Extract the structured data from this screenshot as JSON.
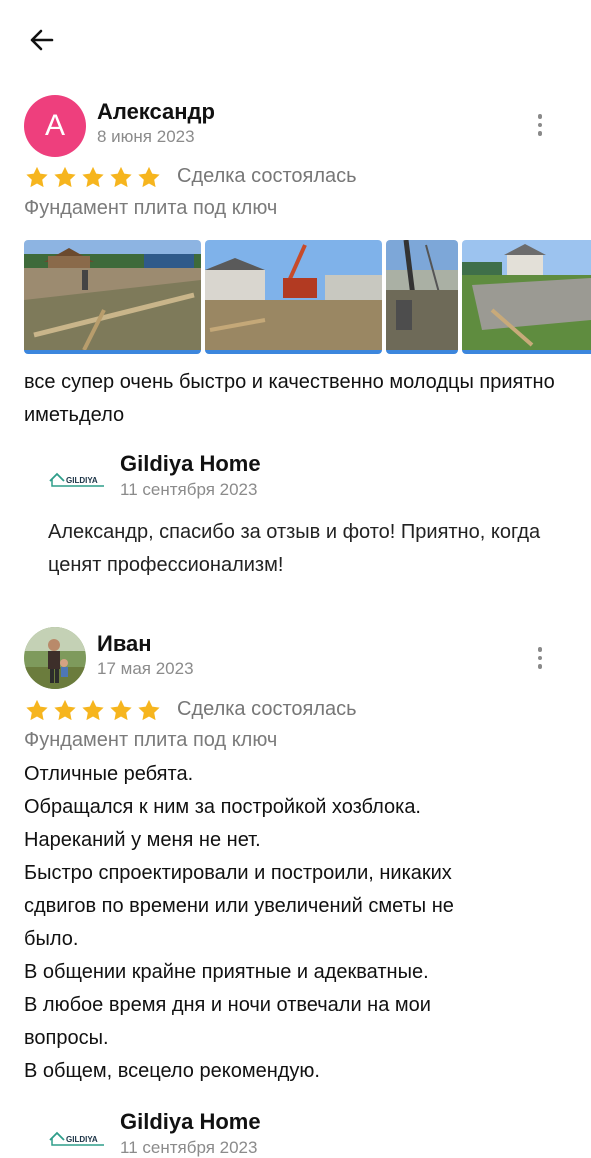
{
  "reviews": [
    {
      "avatar_letter": "А",
      "avatar_color": "#ee3f7d",
      "name": "Александр",
      "date": "8 июня 2023",
      "rating": 5,
      "deal_status": "Сделка состоялась",
      "service": "Фундамент плита под ключ",
      "photos": [
        "site-photo",
        "site-photo",
        "site-photo",
        "site-photo"
      ],
      "text": "все супер очень быстро и качественно молодцы приятно иметьдело",
      "reply": {
        "company": "Gildiya Home",
        "date": "11 сентября 2023",
        "text": "Александр, спасибо за отзыв и фото! Приятно, когда ценят профессионализм!"
      }
    },
    {
      "name": "Иван",
      "date": "17 мая 2023",
      "rating": 5,
      "deal_status": "Сделка состоялась",
      "service": "Фундамент плита под ключ",
      "text_lines": [
        "Отличные ребята.",
        "Обращался к ним за постройкой хозблока.",
        "Нареканий у меня не нет.",
        "Быстро спроектировали и построили, никаких",
        "сдвигов по времени или увеличений сметы не",
        "было.",
        "В общении крайне приятные и адекватные.",
        "В любое время дня и ночи отвечали на мои",
        "вопросы.",
        "В общем, всецело рекомендую."
      ],
      "reply": {
        "company": "Gildiya Home",
        "date": "11 сентября 2023"
      }
    }
  ],
  "logo_text": "GILDIYA",
  "star_color": "#f6b51e"
}
